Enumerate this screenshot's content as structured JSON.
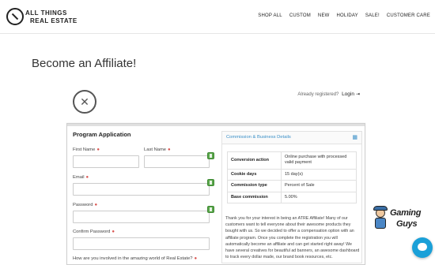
{
  "header": {
    "logo_line1": "ALL THINGS",
    "logo_line2": "REAL ESTATE",
    "nav": [
      "SHOP ALL",
      "CUSTOM",
      "NEW",
      "HOLIDAY",
      "SALE!",
      "CUSTOMER CARE"
    ]
  },
  "page": {
    "title": "Become an Affiliate!"
  },
  "login": {
    "prompt": "Already registered?",
    "link": "Login"
  },
  "form": {
    "title": "Program Application",
    "first_name": "First Name",
    "last_name": "Last Name",
    "email": "Email",
    "password": "Password",
    "confirm_password": "Confirm Password",
    "question": "How are you involved in the amazing world of Real Estate?",
    "required_marker": "●"
  },
  "panel": {
    "title": "Commission & Business Details",
    "rows": [
      {
        "key": "Conversion action",
        "value": "Online purchase with processed valid payment"
      },
      {
        "key": "Cookie days",
        "value": "15 day(s)"
      },
      {
        "key": "Commission type",
        "value": "Percent of Sale"
      },
      {
        "key": "Base commission",
        "value": "5.00%"
      }
    ],
    "description": "Thank you for your interest in being an ATRE Affiliate! Many of our customers want to tell everyone about their awesome products they bought with us.  So we decided to offer a compensation option with an affiliate program. Once you complete the registration you will automatically become an affiliate and can get started right away!  We have several creatives for beautiful ad banners, an awesome dashboard to track every dollar made, our brand book resources, etc."
  },
  "overlay": {
    "brand_line1": "Gaming",
    "brand_line2": "Guys"
  },
  "colors": {
    "accent": "#3a8fc7",
    "required": "#d9534f",
    "chat": "#1aa0d8",
    "icon_green": "#5aa64b"
  }
}
